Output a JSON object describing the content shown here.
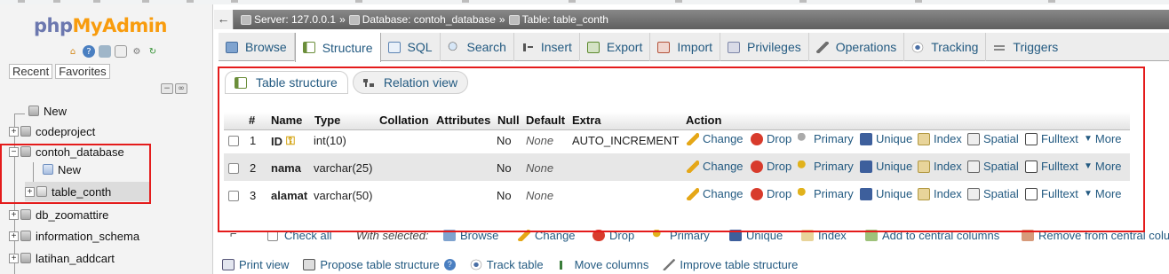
{
  "app": {
    "logo_php": "php",
    "logo_my": "My",
    "logo_admin": "Admin"
  },
  "nav": {
    "tab_recent": "Recent",
    "tab_favorites": "Favorites",
    "tree": [
      {
        "label": "New"
      },
      {
        "label": "codeproject"
      },
      {
        "label": "contoh_database"
      },
      {
        "label": "New"
      },
      {
        "label": "table_conth"
      },
      {
        "label": "db_zoomattire"
      },
      {
        "label": "information_schema"
      },
      {
        "label": "latihan_addcart"
      }
    ]
  },
  "breadcrumb": {
    "server": "Server: 127.0.0.1",
    "database": "Database: contoh_database",
    "table": "Table: table_conth",
    "separator": "»"
  },
  "tabs": [
    {
      "label": "Browse",
      "icon": "browse-icon"
    },
    {
      "label": "Structure",
      "icon": "structure-icon"
    },
    {
      "label": "SQL",
      "icon": "sql-icon"
    },
    {
      "label": "Search",
      "icon": "search-icon"
    },
    {
      "label": "Insert",
      "icon": "insert-icon"
    },
    {
      "label": "Export",
      "icon": "export-icon"
    },
    {
      "label": "Import",
      "icon": "import-icon"
    },
    {
      "label": "Privileges",
      "icon": "privileges-icon"
    },
    {
      "label": "Operations",
      "icon": "operations-icon"
    },
    {
      "label": "Tracking",
      "icon": "tracking-icon"
    },
    {
      "label": "Triggers",
      "icon": "triggers-icon"
    }
  ],
  "subtabs": {
    "table_structure": "Table structure",
    "relation_view": "Relation view"
  },
  "table": {
    "headers": {
      "num": "#",
      "name": "Name",
      "type": "Type",
      "collation": "Collation",
      "attributes": "Attributes",
      "null": "Null",
      "default": "Default",
      "extra": "Extra",
      "action": "Action"
    },
    "rows": [
      {
        "num": "1",
        "name": "ID",
        "type": "int(10)",
        "null": "No",
        "default": "None",
        "extra": "AUTO_INCREMENT"
      },
      {
        "num": "2",
        "name": "nama",
        "type": "varchar(25)",
        "null": "No",
        "default": "None",
        "extra": ""
      },
      {
        "num": "3",
        "name": "alamat",
        "type": "varchar(50)",
        "null": "No",
        "default": "None",
        "extra": ""
      }
    ],
    "actions": {
      "change": "Change",
      "drop": "Drop",
      "primary": "Primary",
      "unique": "Unique",
      "index": "Index",
      "spatial": "Spatial",
      "fulltext": "Fulltext",
      "more": "More"
    }
  },
  "with_selected": {
    "check_all": "Check all",
    "label": "With selected:",
    "browse": "Browse",
    "change": "Change",
    "drop": "Drop",
    "primary": "Primary",
    "unique": "Unique",
    "index": "Index",
    "add_central": "Add to central columns",
    "remove_central": "Remove from central colu"
  },
  "bottom": {
    "print_view": "Print view",
    "propose": "Propose table structure",
    "track": "Track table",
    "move": "Move columns",
    "improve": "Improve table structure"
  },
  "colors": {
    "link": "#235a81",
    "highlight": "#e41b1b",
    "logo_blue": "#6c78af",
    "logo_orange": "#f89c0e"
  }
}
